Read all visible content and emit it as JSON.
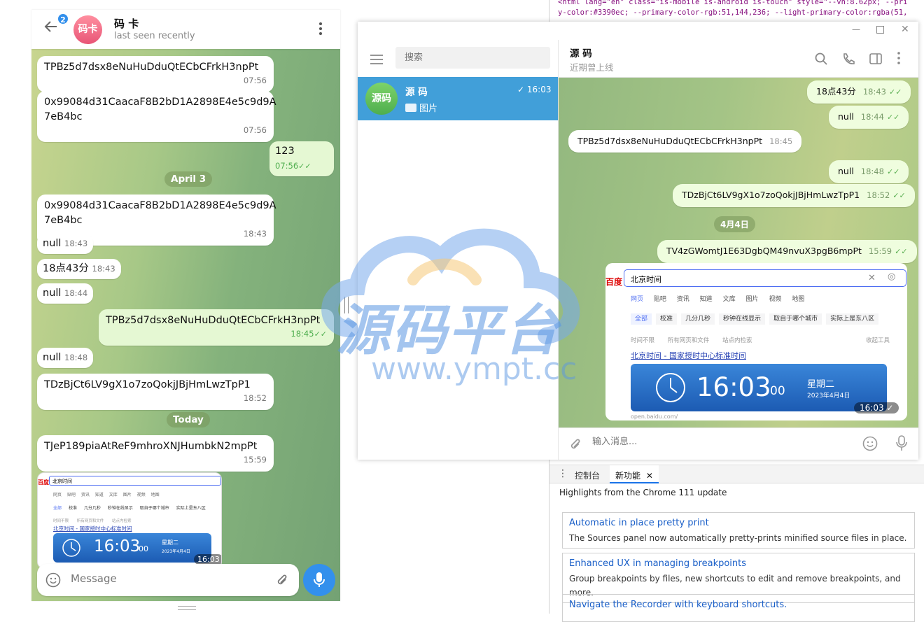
{
  "left_app": {
    "header": {
      "back_badge": "2",
      "avatar_text": "码卡",
      "title": "码 卡",
      "status": "last seen recently"
    },
    "messages": [
      {
        "text": "TPBz5d7dsx8eNuHuDduQtECbCFrkH3npPt",
        "time": "07:56"
      },
      {
        "text": "0x99084d31CaacaF8B2bD1A2898E4e5c9d9A",
        "text2": "7eB4bc",
        "time": "07:56"
      },
      {
        "text": "123",
        "time": "07:56"
      },
      {
        "text": "0x99084d31CaacaF8B2bD1A2898E4e5c9d9A",
        "text2": "7eB4bc",
        "time": "18:43"
      },
      {
        "text": "null",
        "time": "18:43"
      },
      {
        "text": "18点43分",
        "time": "18:43"
      },
      {
        "text": "null",
        "time": "18:44"
      },
      {
        "text": "TPBz5d7dsx8eNuHuDduQtECbCFrkH3npPt",
        "time": "18:45"
      },
      {
        "text": "null",
        "time": "18:48"
      },
      {
        "text": "TDzBjCt6LV9gX1o7zoQokjJBjHmLwzTpP1",
        "time": "18:52"
      },
      {
        "text": "TJeP189piaAtReF9mhroXNJHumbkN2mpPt",
        "time": "15:59"
      }
    ],
    "dates": [
      "April 3",
      "Today"
    ],
    "image_time": "16:03",
    "compose_placeholder": "Message"
  },
  "screenshot_mock": {
    "search_text": "北京时间",
    "tabs": [
      "网页",
      "贴吧",
      "资讯",
      "知道",
      "文库",
      "图片",
      "视频",
      "地图"
    ],
    "chips": [
      "全部",
      "校准",
      "几分几秒",
      "秒钟在线显示",
      "取自于哪个城市",
      "实际上是东八区"
    ],
    "filters": [
      "时间不限",
      "所有网页和文件",
      "站点内检索"
    ],
    "tools": "收起工具",
    "result_title": "北京时间 - 国家授时中心标准时间",
    "clock_time": "16:03",
    "clock_sec": "00",
    "weekday": "星期二",
    "date": "2023年4月4日",
    "url": "open.baidu.com/",
    "logo": "百度"
  },
  "mid_app": {
    "search_placeholder": "搜索",
    "chat_item": {
      "avatar": "源码",
      "name": "源 码",
      "time": "16:03",
      "preview": "图片"
    },
    "header": {
      "name": "源 码",
      "status": "近期曾上线"
    },
    "messages": [
      {
        "text": "18点43分",
        "time": "18:43",
        "dir": "out"
      },
      {
        "text": "null",
        "time": "18:44",
        "dir": "out"
      },
      {
        "text": "TPBz5d7dsx8eNuHuDduQtECbCFrkH3npPt",
        "time": "18:45",
        "dir": "in"
      },
      {
        "text": "null",
        "time": "18:48",
        "dir": "out"
      },
      {
        "text": "TDzBjCt6LV9gX1o7zoQokjJBjHmLwzTpP1",
        "time": "18:52",
        "dir": "out"
      },
      {
        "text": "TV4zGWomtJ1E63DgbQM49nvuX3pgB6mpPt",
        "time": "15:59",
        "dir": "out"
      }
    ],
    "date_pill": "4月4日",
    "image_time": "16:03",
    "compose_placeholder": "输入消息..."
  },
  "devtools": {
    "code_line1": "<html lang=\"en\" class=\"is-mobile is-android is-touch\" style=\"--vh:8.62px; --pri",
    "code_line2": "y-color:#3390ec; --primary-color-rgb:51,144,236; --light-primary-color:rgba(51,",
    "tabs": [
      "控制台",
      "新功能"
    ],
    "highlights": "Highlights from the Chrome 111 update",
    "cards": [
      {
        "title": "Automatic in place pretty print",
        "desc": "The Sources panel now automatically pretty-prints minified source files in place."
      },
      {
        "title": "Enhanced UX in managing breakpoints",
        "desc": "Group breakpoints by files, new shortcuts to edit and remove breakpoints, and more."
      },
      {
        "title": "Navigate the Recorder with keyboard shortcuts.",
        "desc": ""
      }
    ]
  },
  "watermark": {
    "title": "源码平台",
    "url": "www.ympt.cc"
  },
  "colors": {
    "accent": "#3390ec",
    "selected": "#419fd9",
    "out_bubble": "#e5f8d3",
    "check": "#4fae4e"
  }
}
